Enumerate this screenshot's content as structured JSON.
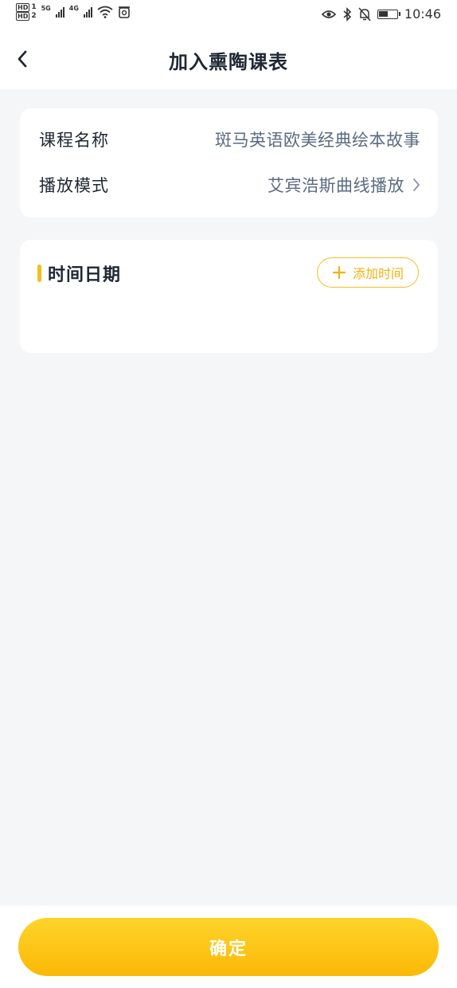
{
  "status_bar": {
    "hd1": "HD",
    "hd1_suffix": "1",
    "hd2": "HD",
    "hd2_suffix": "2",
    "net1": "5G",
    "net2": "4G",
    "time": "10:46"
  },
  "header": {
    "title": "加入熏陶课表"
  },
  "course_info": {
    "name_label": "课程名称",
    "name_value": "斑马英语欧美经典绘本故事",
    "mode_label": "播放模式",
    "mode_value": "艾宾浩斯曲线播放"
  },
  "time_section": {
    "title": "时间日期",
    "add_button_label": "添加时间"
  },
  "footer": {
    "confirm_label": "确定"
  },
  "colors": {
    "accent": "#f6be1a",
    "button_gradient_top": "#fed42a",
    "button_gradient_bottom": "#fbb806",
    "background": "#f5f6f8",
    "value_text": "#5b6b80"
  }
}
